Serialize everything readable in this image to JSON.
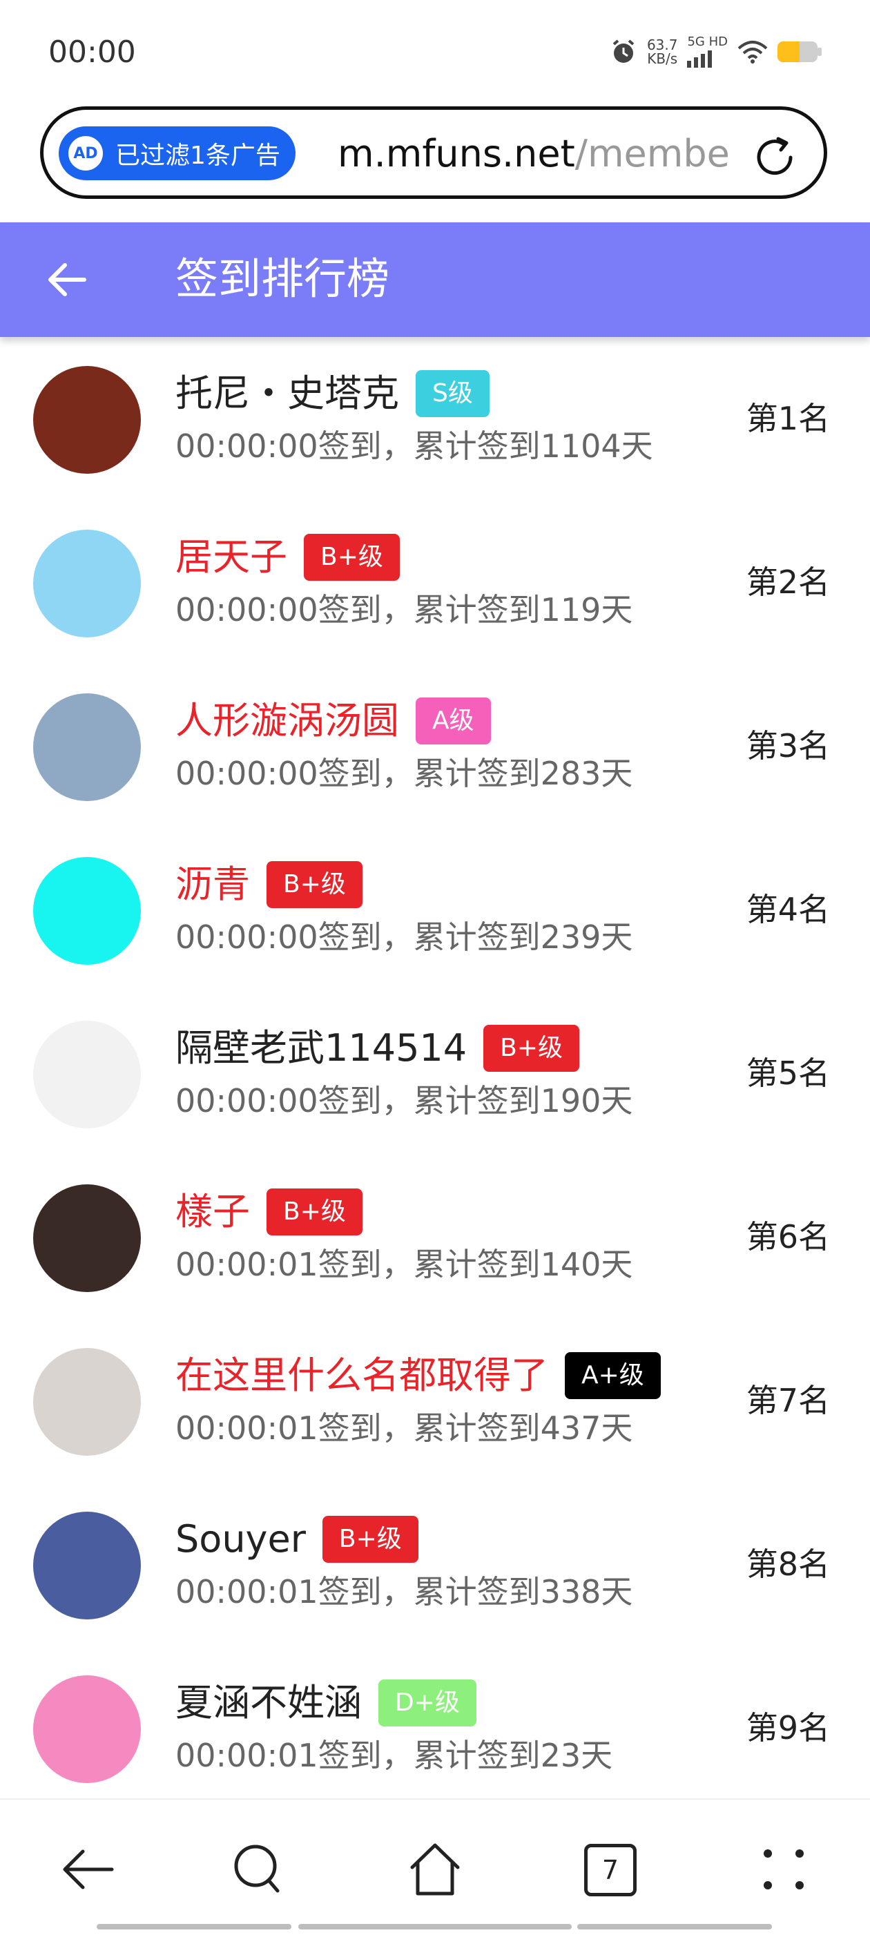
{
  "status_bar": {
    "time": "00:00",
    "net_speed_value": "63.7",
    "net_speed_unit": "KB/s",
    "network_type": "5G HD",
    "battery_level": 0.55
  },
  "url_bar": {
    "ad_filter_label": "已过滤1条广告",
    "ad_icon_text": "AD",
    "host": "m.mfuns.net",
    "path": "/membe"
  },
  "app_bar": {
    "title": "签到排行榜"
  },
  "entries": [
    {
      "name": "托尼・史塔克",
      "name_color": "#222222",
      "level": "S级",
      "level_color": "#3ccfe0",
      "detail": "00:00:00签到，累计签到1104天",
      "rank": "第1名",
      "avatar_bg": "#7a2a1a"
    },
    {
      "name": "居天子",
      "name_color": "#e8242b",
      "level": "B+级",
      "level_color": "#e8242b",
      "detail": "00:00:00签到，累计签到119天",
      "rank": "第2名",
      "avatar_bg": "#8fd6f5"
    },
    {
      "name": "人形漩涡汤圆",
      "name_color": "#e8242b",
      "level": "A级",
      "level_color": "#f560bb",
      "detail": "00:00:00签到，累计签到283天",
      "rank": "第3名",
      "avatar_bg": "#8fa9c4"
    },
    {
      "name": "沥青",
      "name_color": "#e8242b",
      "level": "B+级",
      "level_color": "#e8242b",
      "detail": "00:00:00签到，累计签到239天",
      "rank": "第4名",
      "avatar_bg": "#18f5f0"
    },
    {
      "name": "隔壁老武114514",
      "name_color": "#222222",
      "level": "B+级",
      "level_color": "#e8242b",
      "detail": "00:00:00签到，累计签到190天",
      "rank": "第5名",
      "avatar_bg": "#f2f2f2"
    },
    {
      "name": "樣子",
      "name_color": "#e8242b",
      "level": "B+级",
      "level_color": "#e8242b",
      "detail": "00:00:01签到，累计签到140天",
      "rank": "第6名",
      "avatar_bg": "#3a2a26"
    },
    {
      "name": "在这里什么名都取得了",
      "name_color": "#e8242b",
      "level": "A+级",
      "level_color": "#000000",
      "detail": "00:00:01签到，累计签到437天",
      "rank": "第7名",
      "avatar_bg": "#d9d4d0"
    },
    {
      "name": "Souyer",
      "name_color": "#222222",
      "level": "B+级",
      "level_color": "#e8242b",
      "detail": "00:00:01签到，累计签到338天",
      "rank": "第8名",
      "avatar_bg": "#4a5d9e"
    },
    {
      "name": "夏涵不姓涵",
      "name_color": "#222222",
      "level": "D+级",
      "level_color": "#8ef07c",
      "detail": "00:00:01签到，累计签到23天",
      "rank": "第9名",
      "avatar_bg": "#f58ac0"
    }
  ],
  "bottom_nav": {
    "tab_count": "7",
    "icons": [
      "back-icon",
      "search-icon",
      "home-icon",
      "tabs-icon",
      "menu-icon"
    ]
  }
}
